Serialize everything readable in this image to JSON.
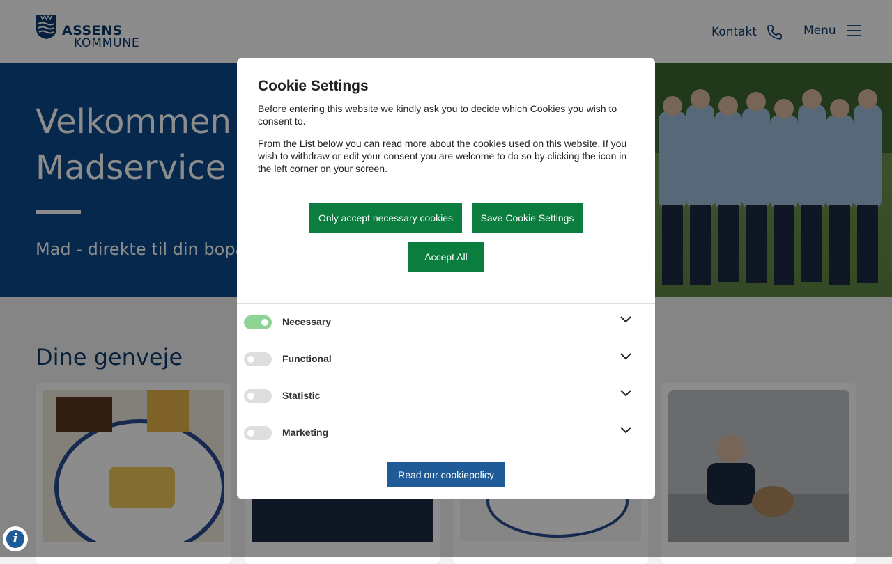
{
  "header": {
    "logo": {
      "line1": "ASSENS",
      "line2": "KOMMUNE"
    },
    "kontakt_label": "Kontakt",
    "menu_label": "Menu",
    "icons": {
      "phone": "phone-icon",
      "menu": "hamburger-menu-icon"
    }
  },
  "hero": {
    "title": "Velkommen til Assens Madservice",
    "subtitle": "Mad - direkte til din bopæl"
  },
  "shortcuts": {
    "title": "Dine genveje"
  },
  "cookie_dialog": {
    "title": "Cookie Settings",
    "paragraph1": "Before entering this website we kindly ask you to decide which Cookies you wish to consent to.",
    "paragraph2": "From the List below you can read more about the cookies used on this website. If you wish to withdraw or edit your consent you are welcome to do so by clicking the icon in the left corner on your screen.",
    "buttons": {
      "only_necessary": "Only accept necessary cookies",
      "save": "Save Cookie Settings",
      "accept_all": "Accept All"
    },
    "categories": [
      {
        "label": "Necessary",
        "enabled": true
      },
      {
        "label": "Functional",
        "enabled": false
      },
      {
        "label": "Statistic",
        "enabled": false
      },
      {
        "label": "Marketing",
        "enabled": false
      }
    ],
    "policy_button": "Read our cookiepolicy"
  },
  "info_button": {
    "glyph": "i"
  },
  "colors": {
    "brand_blue": "#0b3b6e",
    "hero_blue": "#0b4a8b",
    "button_green": "#0b7d3e",
    "policy_blue": "#1f5a99",
    "toggle_on": "#8fd494"
  }
}
